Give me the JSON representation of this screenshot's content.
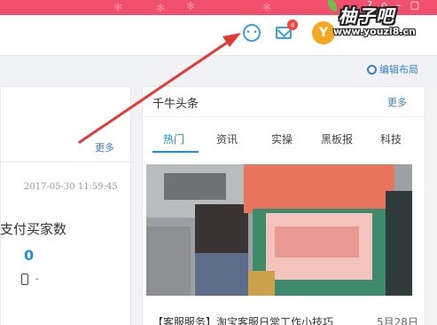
{
  "header": {
    "mail_badge_count": "4",
    "avatar_letter": "Y"
  },
  "logo": {
    "title": "柚子吧",
    "url": "www.youzi8.cn"
  },
  "toolbar": {
    "edit_layout_label": "编辑布局"
  },
  "left_panel": {
    "more_label": "更多",
    "date": "2017-05-30 11:59:45",
    "title": "支付买家数",
    "value": "0",
    "secondary_value": "-"
  },
  "news_panel": {
    "title": "千牛头条",
    "more_label": "更多",
    "tabs": [
      {
        "label": "热门",
        "active": true
      },
      {
        "label": "资讯",
        "active": false
      },
      {
        "label": "实操",
        "active": false
      },
      {
        "label": "黑板报",
        "active": false
      },
      {
        "label": "科技",
        "active": false
      }
    ],
    "headline": "【客服服务】淘宝客服日常工作小技巧",
    "headline_date": "5月28日"
  },
  "colors": {
    "title_bar": "#f0506e",
    "accent_blue": "#1a8fe0",
    "link_blue": "#3d7fc4",
    "annotation_arrow": "#e53935"
  }
}
